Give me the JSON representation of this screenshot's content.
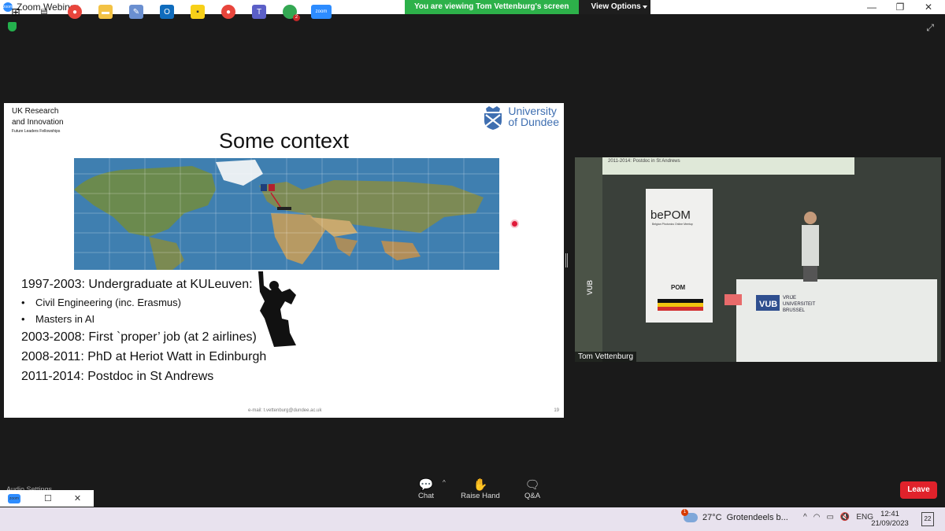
{
  "window": {
    "title": "Zoom Webinar",
    "minimize": "—",
    "restore": "❐",
    "close": "✕"
  },
  "share_banner": {
    "message": "You are viewing Tom Vettenburg's screen",
    "options_label": "View Options"
  },
  "slide": {
    "org_line1": "UK Research",
    "org_line2": "and Innovation",
    "org_line3": "Future Leaders Fellowships",
    "uni_line1": "University",
    "uni_line2": "of Dundee",
    "title": "Some context",
    "items": [
      {
        "kind": "main",
        "text": "1997-2003: Undergraduate at KULeuven:"
      },
      {
        "kind": "sub",
        "text": "Civil Engineering (inc. Erasmus)"
      },
      {
        "kind": "sub",
        "text": "Masters in AI"
      },
      {
        "kind": "main",
        "text": "2003-2008: First `proper’ job (at 2 airlines)"
      },
      {
        "kind": "main",
        "text": "2008-2011: PhD at Heriot Watt in Edinburgh"
      },
      {
        "kind": "main",
        "text": "2011-2014: Postdoc in St Andrews"
      }
    ],
    "footer_email": "e-mail: t.vettenburg@dundee.ac.uk",
    "page_number": "19"
  },
  "video": {
    "participant_name": "Tom Vettenburg",
    "projected_text": "2011-2014: Postdoc in St Andrews",
    "banner_logo": "bePOM",
    "banner_sub": "Belgian Photonics Online Meetup",
    "banner_pom": "POM",
    "lectern_logo": "VUB",
    "lectern_text1": "VRIJE",
    "lectern_text2": "UNIVERSITEIT",
    "lectern_text3": "BRUSSEL",
    "side_banner": "VUB"
  },
  "toolbar": {
    "audio_settings": "Audio Settings",
    "chat": "Chat",
    "raise_hand": "Raise Hand",
    "qa": "Q&A",
    "leave": "Leave"
  },
  "taskbar": {
    "weather_temp": "27°C",
    "weather_desc": "Grotendeels b...",
    "weather_badge": "1",
    "lang": "ENG",
    "time": "12:41",
    "date": "21/09/2023",
    "notifications": "22",
    "teams_badge": "2"
  }
}
